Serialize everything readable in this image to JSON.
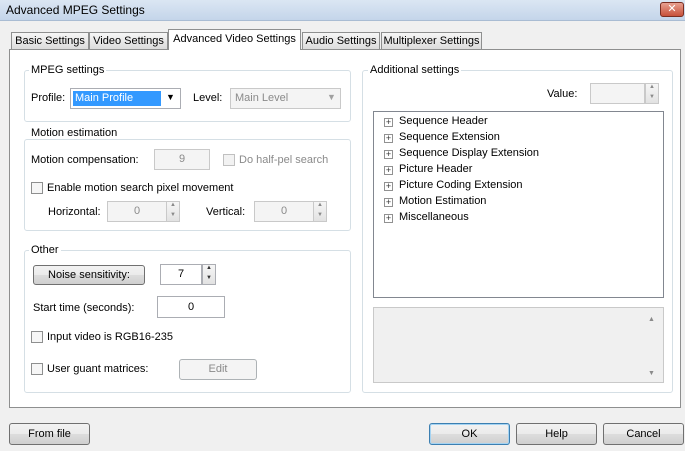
{
  "window": {
    "title": "Advanced MPEG Settings",
    "close_glyph": "✕"
  },
  "tabs": [
    {
      "label": "Basic Settings"
    },
    {
      "label": "Video Settings"
    },
    {
      "label": "Advanced Video Settings",
      "active": true
    },
    {
      "label": "Audio Settings"
    },
    {
      "label": "Multiplexer Settings"
    }
  ],
  "mpeg_settings": {
    "title": "MPEG settings",
    "profile_label": "Profile:",
    "profile_value": "Main Profile",
    "level_label": "Level:",
    "level_value": "Main Level"
  },
  "motion_estimation": {
    "title": "Motion estimation",
    "compensation_label": "Motion compensation:",
    "compensation_value": "9",
    "half_pel_label": "Do half-pel search",
    "pixel_movement_label": "Enable motion search pixel movement",
    "horizontal_label": "Horizontal:",
    "horizontal_value": "0",
    "vertical_label": "Vertical:",
    "vertical_value": "0"
  },
  "other": {
    "title": "Other",
    "noise_button_label": "Noise sensitivity:",
    "noise_value": "7",
    "start_time_label": "Start time (seconds):",
    "start_time_value": "0",
    "rgb_label": "Input video is RGB16-235",
    "user_matrices_label": "User guant matrices:",
    "edit_button_label": "Edit"
  },
  "additional_settings": {
    "title": "Additional settings",
    "value_label": "Value:",
    "value": "",
    "tree_items": [
      "Sequence Header",
      "Sequence Extension",
      "Sequence Display Extension",
      "Picture Header",
      "Picture Coding Extension",
      "Motion Estimation",
      "Miscellaneous"
    ]
  },
  "footer": {
    "from_file_label": "From file",
    "ok_label": "OK",
    "help_label": "Help",
    "cancel_label": "Cancel"
  },
  "icons": {
    "dropdown_arrow": "▼",
    "spin_up": "▲",
    "spin_down": "▼",
    "tree_expand": "+"
  }
}
